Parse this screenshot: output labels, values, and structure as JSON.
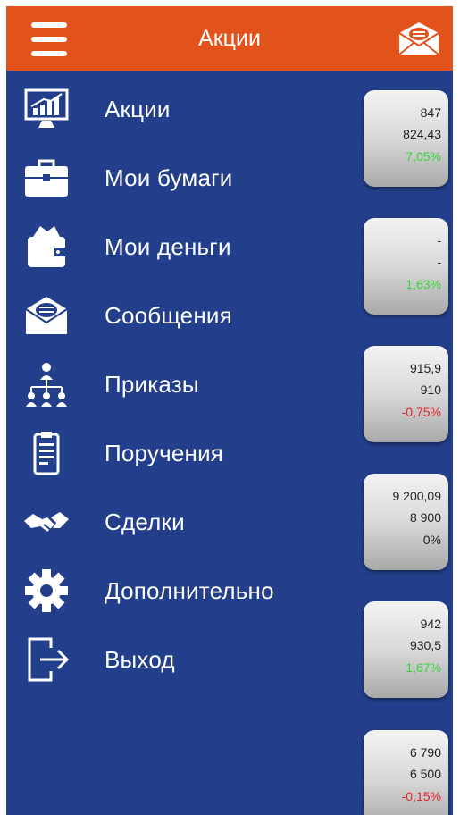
{
  "header": {
    "title": "Акции",
    "menu_icon": "hamburger-icon",
    "mail_icon": "envelope-icon"
  },
  "menu": [
    {
      "label": "Акции",
      "icon": "stock-chart-icon"
    },
    {
      "label": "Мои бумаги",
      "icon": "briefcase-icon"
    },
    {
      "label": "Мои деньги",
      "icon": "wallet-icon"
    },
    {
      "label": "Сообщения",
      "icon": "envelope-icon"
    },
    {
      "label": "Приказы",
      "icon": "org-structure-icon"
    },
    {
      "label": "Поручения",
      "icon": "clipboard-icon"
    },
    {
      "label": "Сделки",
      "icon": "handshake-icon"
    },
    {
      "label": "Дополнительно",
      "icon": "gear-icon"
    },
    {
      "label": "Выход",
      "icon": "logout-icon"
    }
  ],
  "quotes": [
    {
      "v1": "847",
      "v2": "824,43",
      "change": "7,05%",
      "trend": "pos"
    },
    {
      "v1": "-",
      "v2": "-",
      "change": "1,63%",
      "trend": "pos"
    },
    {
      "v1": "915,9",
      "v2": "910",
      "change": "-0,75%",
      "trend": "neg"
    },
    {
      "v1": "9 200,09",
      "v2": "8 900",
      "change": "0%",
      "trend": "zero"
    },
    {
      "v1": "942",
      "v2": "930,5",
      "change": "1,67%",
      "trend": "pos"
    },
    {
      "v1": "6 790",
      "v2": "6 500",
      "change": "-0,15%",
      "trend": "neg"
    }
  ],
  "colors": {
    "header": "#e2521b",
    "background": "#233f8c",
    "positive": "#37d63a",
    "negative": "#e2262a"
  }
}
